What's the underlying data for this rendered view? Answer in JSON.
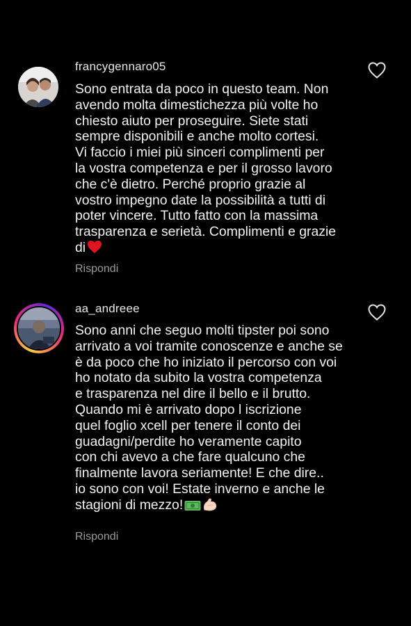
{
  "comments": [
    {
      "username": "francygennaro05",
      "text": "Sono entrata da poco in questo team. Non\navendo molta dimestichezza più volte ho\nchiesto aiuto per proseguire. Siete stati\nsempre disponibili e anche molto cortesi.\nVi faccio i miei più sinceri complimenti per\nla vostra competenza e per il grosso lavoro\nche c'è dietro. Perché proprio grazie al\nvostro impegno date la possibilità a tutti di\npoter vincere. Tutto fatto con la massima\ntrasparenza e serietà. Complimenti e grazie\ndi",
      "emoji_end": "red-heart-emoji",
      "reply_label": "Rispondi",
      "like_icon": "heart-outline-icon"
    },
    {
      "username": "aa_andreee",
      "text": "Sono anni che seguo molti tipster poi sono\narrivato a voi tramite conoscenze e anche se\nè da poco che ho iniziato il percorso con voi\nho notato da subito la vostra competenza\ne trasparenza nel dire il bello e il brutto.\nQuando mi è arrivato dopo l iscrizione\nquel foglio xcell per tenere il conto dei\nguadagni/perdite ho veramente capito\ncon chi avevo a che fare qualcuno che\nfinalmente lavora seriamente! E che dire..\nio sono con voi! Estate inverno e anche le\nstagioni di mezzo!",
      "emoji_end": [
        "money-emoji",
        "flexed-biceps-emoji"
      ],
      "reply_label": "Rispondi",
      "like_icon": "heart-outline-icon",
      "has_story_ring": true
    }
  ],
  "colors": {
    "background": "#000000",
    "text": "#f1f1f1",
    "secondary_text": "#9a9a9a",
    "heart_emoji": "#e0141e"
  }
}
